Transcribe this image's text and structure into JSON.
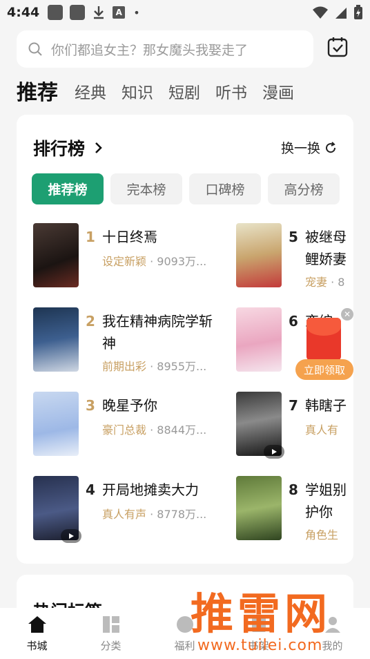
{
  "status_bar": {
    "time": "4:44"
  },
  "search": {
    "placeholder": "你们都追女主？那女魔头我娶走了"
  },
  "tabs": [
    "推荐",
    "经典",
    "知识",
    "短剧",
    "听书",
    "漫画"
  ],
  "ranking": {
    "title": "排行榜",
    "refresh_label": "换一换",
    "pills": [
      "推荐榜",
      "完本榜",
      "口碑榜",
      "高分榜"
    ],
    "books": [
      {
        "rank": "1",
        "title": "十日终焉",
        "title2": "",
        "tag": "设定新颖",
        "count": "9093万..."
      },
      {
        "rank": "2",
        "title": "我在精神病院学斩",
        "title2": "神",
        "tag": "前期出彩",
        "count": "8955万..."
      },
      {
        "rank": "3",
        "title": "晚星予你",
        "title2": "",
        "tag": "豪门总裁",
        "count": "8844万..."
      },
      {
        "rank": "4",
        "title": "开局地摊卖大力",
        "title2": "",
        "tag": "真人有声",
        "count": "8778万..."
      },
      {
        "rank": "5",
        "title": "被继母",
        "title2": "鲤娇妻",
        "tag": "宠妻",
        "count": "8"
      },
      {
        "rank": "6",
        "title": "恋综",
        "title2": "",
        "tag": "",
        "count": ""
      },
      {
        "rank": "7",
        "title": "韩瞎子",
        "title2": "",
        "tag": "真人有",
        "count": ""
      },
      {
        "rank": "8",
        "title": "学姐别",
        "title2": "护你",
        "tag": "角色生",
        "count": ""
      }
    ],
    "rank_colors": {
      "top3": "#c8a063",
      "rest": "#222222"
    }
  },
  "red_packet": {
    "label": "立即领取"
  },
  "hot_tags": {
    "title": "热门标签"
  },
  "bottom_nav": [
    "书城",
    "分类",
    "福利",
    "书架",
    "我的"
  ],
  "watermark": {
    "logo": "推雷网",
    "url": "www.tuilei.com"
  },
  "colors": {
    "accent": "#1d9f72",
    "tag": "#c8a063",
    "watermark": "#f26a20"
  }
}
